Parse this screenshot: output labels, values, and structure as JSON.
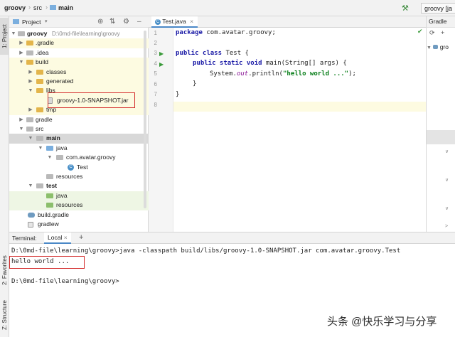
{
  "breadcrumb": {
    "project": "groovy",
    "src": "src",
    "main": "main",
    "run_config": "groovy [ja"
  },
  "left_strip": {
    "project_tab": "1: Project",
    "favorites_tab": "2: Favorites",
    "structure_tab": "Z: Structure"
  },
  "project_panel": {
    "title": "Project",
    "tree": [
      {
        "label": "groovy",
        "extra": "D:\\0md-file\\learning\\groovy",
        "bold": true
      },
      {
        "label": ".gradle"
      },
      {
        "label": ".idea"
      },
      {
        "label": "build"
      },
      {
        "label": "classes"
      },
      {
        "label": "generated"
      },
      {
        "label": "libs"
      },
      {
        "label": "groovy-1.0-SNAPSHOT.jar"
      },
      {
        "label": "tmp"
      },
      {
        "label": "gradle"
      },
      {
        "label": "src"
      },
      {
        "label": "main",
        "bold": true
      },
      {
        "label": "java"
      },
      {
        "label": "com.avatar.groovy"
      },
      {
        "label": "Test"
      },
      {
        "label": "resources"
      },
      {
        "label": "test",
        "bold": true
      },
      {
        "label": "java"
      },
      {
        "label": "resources"
      },
      {
        "label": "build.gradle"
      },
      {
        "label": "gradlew"
      }
    ]
  },
  "editor": {
    "tab": "Test.java",
    "line_numbers": [
      "1",
      "2",
      "3",
      "4",
      "5",
      "6",
      "7",
      "8"
    ],
    "code": {
      "l1_kw": "package",
      "l1_rest": " com.avatar.groovy;",
      "l3_kw": "public class",
      "l3_rest": " Test {",
      "l4_kw": "public static void",
      "l4_rest": " main(String[] args) {",
      "l5_pre": "System.",
      "l5_field": "out",
      "l5_mid": ".println(",
      "l5_str": "\"hello world ...\"",
      "l5_post": ");",
      "l6": "}",
      "l7": "}"
    }
  },
  "gradle_panel": {
    "title": "Gradle",
    "item": "gro"
  },
  "terminal": {
    "label": "Terminal:",
    "tab": "Local",
    "add": "+",
    "lines": [
      "D:\\0md-file\\learning\\groovy>java -classpath build/libs/groovy-1.0-SNAPSHOT.jar com.avatar.groovy.Test",
      "hello world ...",
      "",
      "D:\\0md-file\\learning\\groovy>"
    ]
  },
  "watermark": "头条 @快乐学习与分享",
  "colors": {
    "keyword": "#1a1aa6",
    "string": "#067d17",
    "highlight_box": "#d32b2b",
    "folder": "#e3b54b"
  }
}
